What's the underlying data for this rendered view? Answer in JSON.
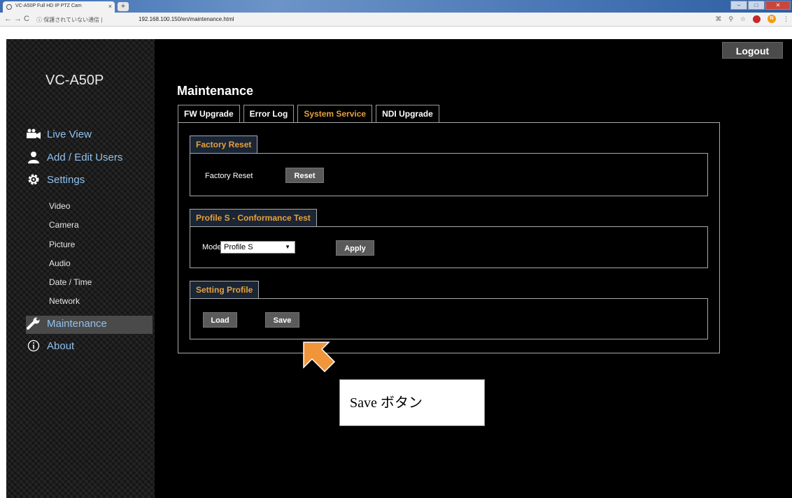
{
  "browser": {
    "tab_title": "VC-A50P Full HD IP PTZ Cam",
    "tab_close": "×",
    "new_tab": "+",
    "security_label": "保護されていない通信",
    "url": "192.168.100.150/en/maintenance.html",
    "profile_badge": "N"
  },
  "sidebar": {
    "brand": "VC-A50P",
    "main_items": [
      {
        "label": "Live View",
        "icon": "video-camera-icon"
      },
      {
        "label": "Add / Edit Users",
        "icon": "user-icon"
      },
      {
        "label": "Settings",
        "icon": "gear-icon"
      }
    ],
    "settings_items": [
      "Video",
      "Camera",
      "Picture",
      "Audio",
      "Date / Time",
      "Network"
    ],
    "maintenance": {
      "label": "Maintenance",
      "icon": "wrench-icon"
    },
    "about": {
      "label": "About",
      "icon": "info-icon"
    }
  },
  "header": {
    "logout": "Logout"
  },
  "page": {
    "title": "Maintenance",
    "tabs": [
      "FW Upgrade",
      "Error Log",
      "System Service",
      "NDI Upgrade"
    ],
    "active_tab": "System Service"
  },
  "factory_reset": {
    "section_title": "Factory Reset",
    "label": "Factory Reset",
    "button": "Reset"
  },
  "conformance": {
    "section_title": "Profile S - Conformance Test",
    "mode_label": "Mode",
    "mode_value": "Profile S",
    "button": "Apply"
  },
  "setting_profile": {
    "section_title": "Setting Profile",
    "load_button": "Load",
    "save_button": "Save"
  },
  "annotation": {
    "callout": "Save ボタン"
  },
  "colors": {
    "accent_orange": "#e8a13a",
    "link_blue": "#8fc1ee",
    "arrow": "#f0953a"
  }
}
